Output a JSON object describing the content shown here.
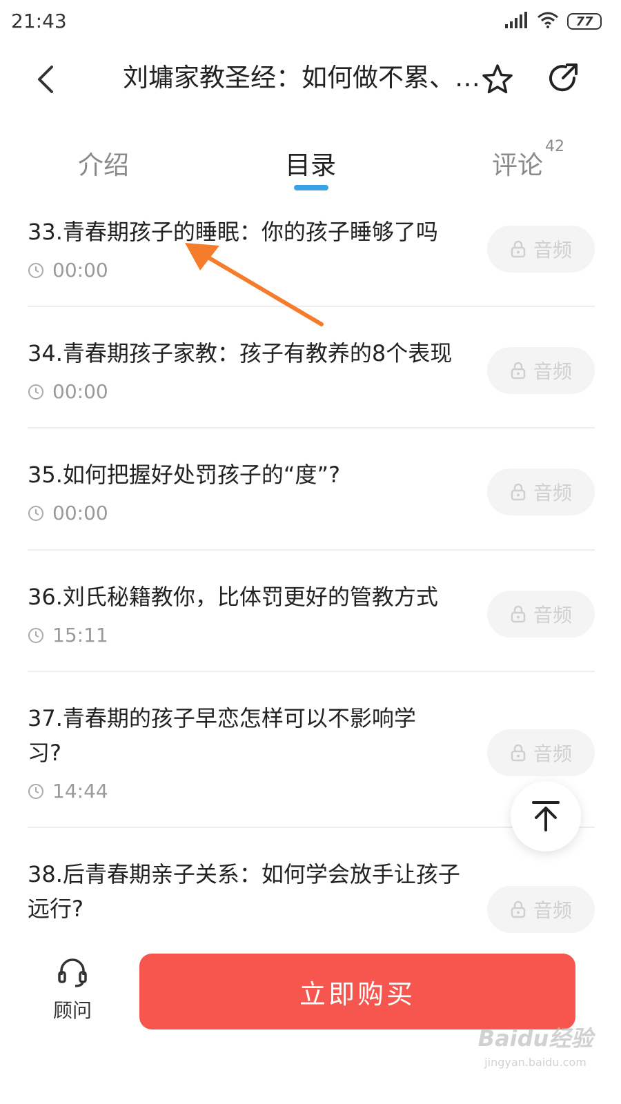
{
  "status_bar": {
    "time": "21:43",
    "battery": "77",
    "icons": [
      "signal-icon",
      "wifi-icon",
      "battery-icon"
    ]
  },
  "header": {
    "title": "刘墉家教圣经：如何做不累、…",
    "icons": [
      "back-arrow-icon",
      "star-icon",
      "share-icon"
    ]
  },
  "tabs": {
    "items": [
      {
        "label": "介绍",
        "active": false
      },
      {
        "label": "目录",
        "active": true
      },
      {
        "label": "评论",
        "active": false,
        "badge": "42"
      }
    ],
    "accent_color": "#3aa3e6"
  },
  "catalog": {
    "items": [
      {
        "title": "33.青春期孩子的睡眠：你的孩子睡够了吗",
        "duration": "00:00",
        "button": "音频"
      },
      {
        "title": "34.青春期孩子家教：孩子有教养的8个表现",
        "duration": "00:00",
        "button": "音频"
      },
      {
        "title": "35.如何把握好处罚孩子的“度”?",
        "duration": "00:00",
        "button": "音频"
      },
      {
        "title": "36.刘氏秘籍教你，比体罚更好的管教方式",
        "duration": "15:11",
        "button": "音频"
      },
      {
        "title": "37.青春期的孩子早恋怎样可以不影响学习?",
        "duration": "14:44",
        "button": "音频"
      },
      {
        "title": "38.后青春期亲子关系：如何学会放手让孩子远行?",
        "duration": "",
        "button": "音频"
      }
    ]
  },
  "bottom_bar": {
    "advisor_label": "顾问",
    "buy_label": "立即购买",
    "buy_color": "#f6564d"
  },
  "annotation": {
    "color": "#f57c2a",
    "icon": "pointer-arrow-icon"
  },
  "watermark": {
    "main": "Baidu经验",
    "sub": "jingyan.baidu.com"
  }
}
